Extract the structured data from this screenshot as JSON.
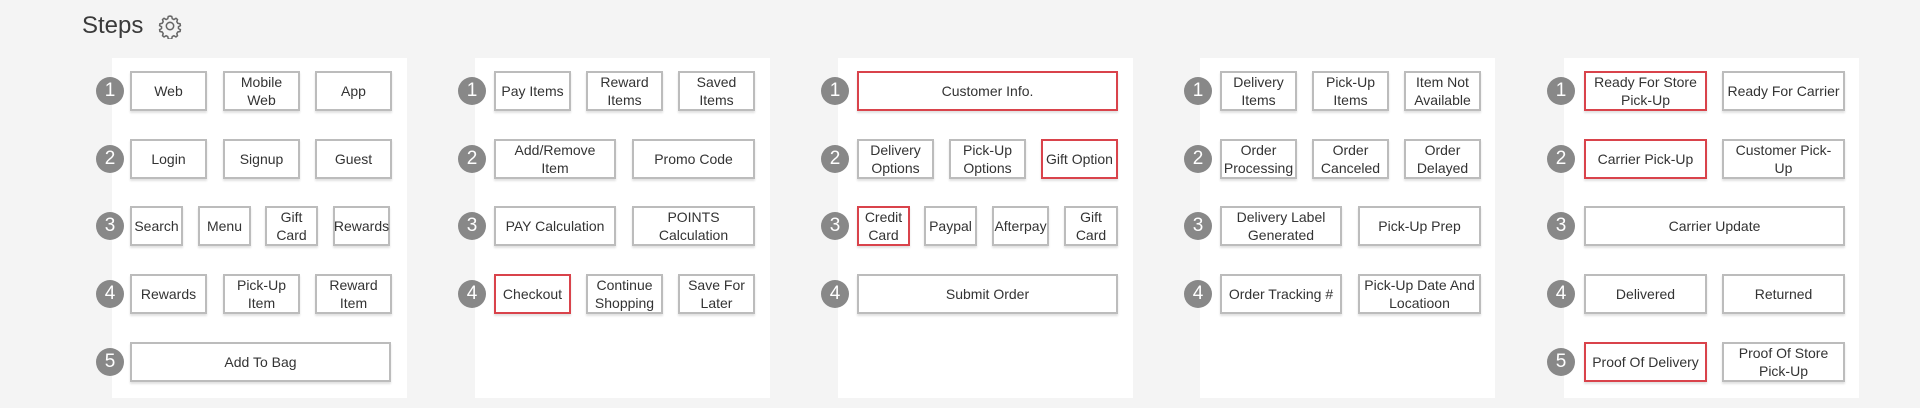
{
  "header": {
    "title": "Steps",
    "settings_icon": "gear-icon"
  },
  "colors": {
    "selected_border": "#d9434b",
    "default_border": "#bcbcbc",
    "badge": "#888888"
  },
  "columns": [
    {
      "rows": [
        {
          "step": "1",
          "options": [
            {
              "label": "Web"
            },
            {
              "label": "Mobile Web"
            },
            {
              "label": "App"
            }
          ]
        },
        {
          "step": "2",
          "options": [
            {
              "label": "Login"
            },
            {
              "label": "Signup"
            },
            {
              "label": "Guest"
            }
          ]
        },
        {
          "step": "3",
          "options": [
            {
              "label": "Search"
            },
            {
              "label": "Menu"
            },
            {
              "label": "Gift Card"
            },
            {
              "label": "Rewards"
            }
          ]
        },
        {
          "step": "4",
          "options": [
            {
              "label": "Rewards"
            },
            {
              "label": "Pick-Up Item"
            },
            {
              "label": "Reward Item"
            }
          ]
        },
        {
          "step": "5",
          "options": [
            {
              "label": "Add To Bag"
            }
          ]
        }
      ]
    },
    {
      "rows": [
        {
          "step": "1",
          "options": [
            {
              "label": "Pay Items"
            },
            {
              "label": "Reward Items"
            },
            {
              "label": "Saved Items"
            }
          ]
        },
        {
          "step": "2",
          "options": [
            {
              "label": "Add/Remove Item"
            },
            {
              "label": "Promo Code"
            }
          ]
        },
        {
          "step": "3",
          "options": [
            {
              "label": "PAY Calculation"
            },
            {
              "label": "POINTS Calculation"
            }
          ]
        },
        {
          "step": "4",
          "options": [
            {
              "label": "Checkout",
              "selected": true
            },
            {
              "label": "Continue Shopping"
            },
            {
              "label": "Save For Later"
            }
          ]
        }
      ]
    },
    {
      "rows": [
        {
          "step": "1",
          "options": [
            {
              "label": "Customer Info.",
              "selected": true
            }
          ]
        },
        {
          "step": "2",
          "options": [
            {
              "label": "Delivery Options"
            },
            {
              "label": "Pick-Up Options"
            },
            {
              "label": "Gift Option",
              "selected": true
            }
          ]
        },
        {
          "step": "3",
          "options": [
            {
              "label": "Credit Card",
              "selected": true
            },
            {
              "label": "Paypal"
            },
            {
              "label": "Afterpay"
            },
            {
              "label": "Gift Card"
            }
          ]
        },
        {
          "step": "4",
          "options": [
            {
              "label": "Submit Order"
            }
          ]
        }
      ]
    },
    {
      "rows": [
        {
          "step": "1",
          "options": [
            {
              "label": "Delivery Items"
            },
            {
              "label": "Pick-Up Items"
            },
            {
              "label": "Item Not Available"
            }
          ]
        },
        {
          "step": "2",
          "options": [
            {
              "label": "Order Processing"
            },
            {
              "label": "Order Canceled"
            },
            {
              "label": "Order Delayed"
            }
          ]
        },
        {
          "step": "3",
          "options": [
            {
              "label": "Delivery Label Generated"
            },
            {
              "label": "Pick-Up Prep"
            }
          ]
        },
        {
          "step": "4",
          "options": [
            {
              "label": "Order Tracking #"
            },
            {
              "label": "Pick-Up Date And Locatioon"
            }
          ]
        }
      ]
    },
    {
      "rows": [
        {
          "step": "1",
          "options": [
            {
              "label": "Ready For Store Pick-Up",
              "selected": true
            },
            {
              "label": "Ready For Carrier"
            }
          ]
        },
        {
          "step": "2",
          "options": [
            {
              "label": "Carrier Pick-Up",
              "selected": true
            },
            {
              "label": "Customer Pick-Up"
            }
          ]
        },
        {
          "step": "3",
          "options": [
            {
              "label": "Carrier Update"
            }
          ]
        },
        {
          "step": "4",
          "options": [
            {
              "label": "Delivered"
            },
            {
              "label": "Returned"
            }
          ]
        },
        {
          "step": "5",
          "options": [
            {
              "label": "Proof Of Delivery",
              "selected": true
            },
            {
              "label": "Proof Of Store Pick-Up"
            }
          ]
        }
      ]
    }
  ]
}
